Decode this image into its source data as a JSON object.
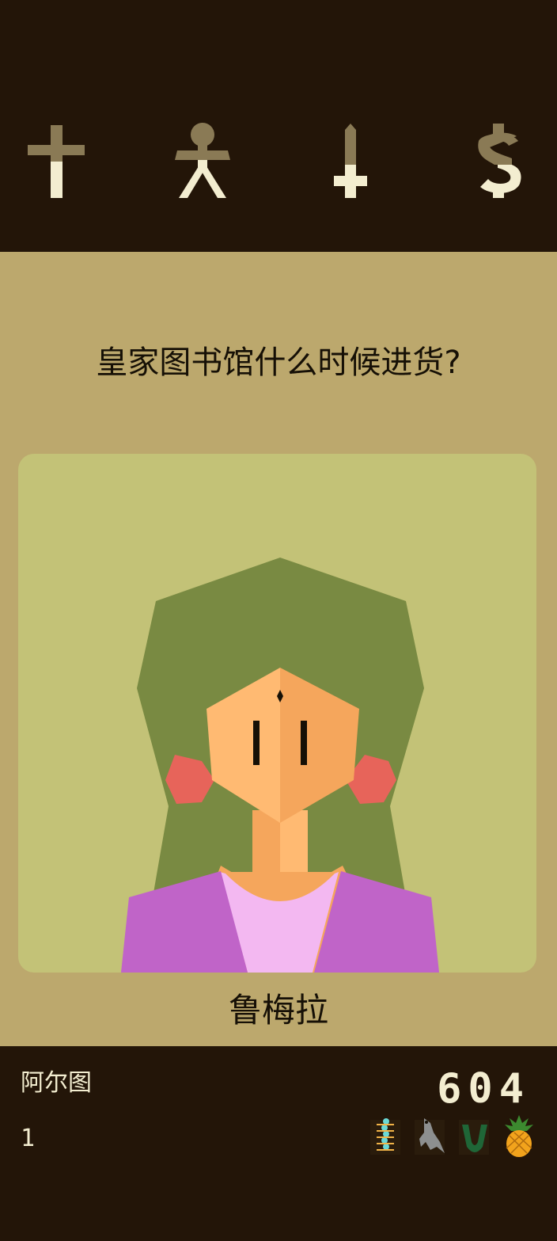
{
  "stats": [
    {
      "id": "church",
      "icon": "cross-icon",
      "level": 0.5
    },
    {
      "id": "people",
      "icon": "person-icon",
      "level": 0.45
    },
    {
      "id": "army",
      "icon": "sword-icon",
      "level": 0.45
    },
    {
      "id": "treasury",
      "icon": "dollar-icon",
      "level": 0.45
    }
  ],
  "card": {
    "question": "皇家图书馆什么时候进货?",
    "character_name": "鲁梅拉"
  },
  "footer": {
    "ruler_name": "阿尔图",
    "years": "1",
    "reign_count": "604",
    "relics": [
      "centipede-icon",
      "crocodile-icon",
      "horseshoe-icon",
      "pineapple-icon"
    ]
  },
  "colors": {
    "bar_bg": "#231508",
    "panel_bg": "#bca86d",
    "card_bg": "#c3c277",
    "stat_full": "#f3edd0",
    "stat_empty": "#8a7a55"
  }
}
